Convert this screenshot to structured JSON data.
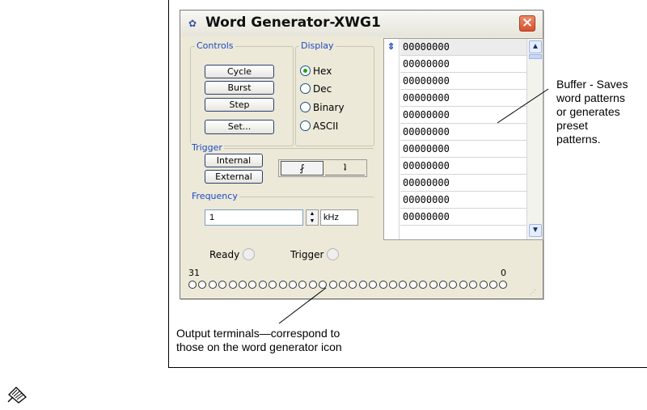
{
  "window": {
    "title": "Word Generator-XWG1",
    "close_label": "×"
  },
  "controls": {
    "legend": "Controls",
    "cycle": "Cycle",
    "burst": "Burst",
    "step": "Step",
    "set": "Set..."
  },
  "display": {
    "legend": "Display",
    "options": [
      {
        "label": "Hex",
        "selected": true
      },
      {
        "label": "Dec",
        "selected": false
      },
      {
        "label": "Binary",
        "selected": false
      },
      {
        "label": "ASCII",
        "selected": false
      }
    ]
  },
  "trigger": {
    "legend": "Trigger",
    "internal": "Internal",
    "external": "External",
    "rising_edge": "⨏",
    "falling_edge": "ʇ"
  },
  "frequency": {
    "legend": "Frequency",
    "value": "1",
    "unit": "kHz"
  },
  "buffer": {
    "rows": [
      "00000000",
      "00000000",
      "00000000",
      "00000000",
      "00000000",
      "00000000",
      "00000000",
      "00000000",
      "00000000",
      "00000000",
      "00000000"
    ]
  },
  "status": {
    "ready": "Ready",
    "trigger": "Trigger",
    "msb": "31",
    "lsb": "0"
  },
  "callouts": {
    "buffer_lines": [
      "Buffer - Saves",
      "word patterns",
      "or generates",
      "preset",
      "patterns."
    ],
    "output_lines": [
      "Output terminals—correspond to",
      "those on the word generator icon"
    ]
  },
  "colors": {
    "legend_blue": "#1c49c6",
    "close_red": "#d9502e",
    "window_bg": "#ece9d8"
  }
}
